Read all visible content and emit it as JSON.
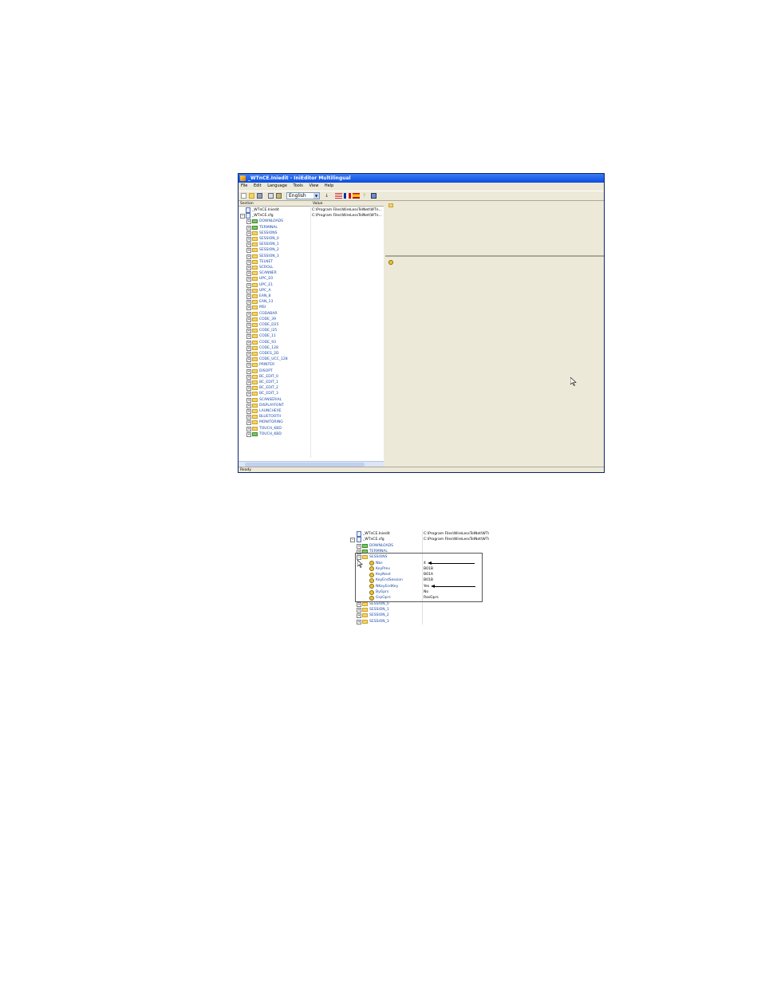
{
  "window": {
    "title": "_WTnCE.Iniedit - IniEditor Multilingual",
    "menu": [
      "File",
      "Edit",
      "Language",
      "Tools",
      "View",
      "Help"
    ],
    "language_selected": "English",
    "columns": {
      "section": "Section",
      "value": "Value"
    },
    "status": "Ready"
  },
  "tree": {
    "root_files": [
      {
        "label": "_WTnCE.Iniedit",
        "value": "C:\\Program Files\\WireLessTelNet\\WTn..."
      },
      {
        "label": "_WTnCE.cfg",
        "value": "C:\\Program Files\\WireLessTelNet\\WTn..."
      }
    ],
    "sections": [
      "DOWNLOADS",
      "TERMINAL",
      "SESSIONS",
      "SESSION_0",
      "SESSION_1",
      "SESSION_2",
      "SESSION_3",
      "TELNET",
      "SCROLL",
      "SCANNER",
      "UPC_E0",
      "UPC_E1",
      "UPC_A",
      "EAN_8",
      "EAN_13",
      "MSI",
      "CODABAR",
      "CODE_39",
      "CODE_D25",
      "CODE_I25",
      "CODE_11",
      "CODE_93",
      "CODE_128",
      "CODES_2D",
      "CODE_UCC_128",
      "PRINTER",
      "DISOPT",
      "BC_EDIT_0",
      "BC_EDIT_1",
      "BC_EDIT_2",
      "BC_EDIT_3",
      "SCANSERIAL",
      "DISPLAYFONT",
      "LAUNCHEXE",
      "BLUETOOTH",
      "MONITORING",
      "TOUCH_KBD",
      "TOUCH_KBD"
    ]
  },
  "detail": {
    "root_files": [
      {
        "label": "_WTnCE.Iniedit",
        "value": "C:\\Program Files\\WireLessTelNet\\WTn"
      },
      {
        "label": "_WTnCE.cfg",
        "value": "C:\\Program Files\\WireLessTelNet\\WTn"
      }
    ],
    "pre_sections": [
      "DOWNLOADS",
      "TERMINAL",
      "SESSIONS"
    ],
    "keys": [
      {
        "key": "Nbs",
        "value": "4"
      },
      {
        "key": "KeyPrev",
        "value": "B01B"
      },
      {
        "key": "KeyNext",
        "value": "B01A"
      },
      {
        "key": "KeyEndSession",
        "value": "B01B"
      },
      {
        "key": "NKeyEndKey",
        "value": "Yes"
      },
      {
        "key": "ByGprs",
        "value": "No"
      },
      {
        "key": "GrpGprs",
        "value": "RasGprs"
      }
    ],
    "post_sections": [
      "SESSION_0",
      "SESSION_1",
      "SESSION_2",
      "SESSION_3"
    ]
  }
}
